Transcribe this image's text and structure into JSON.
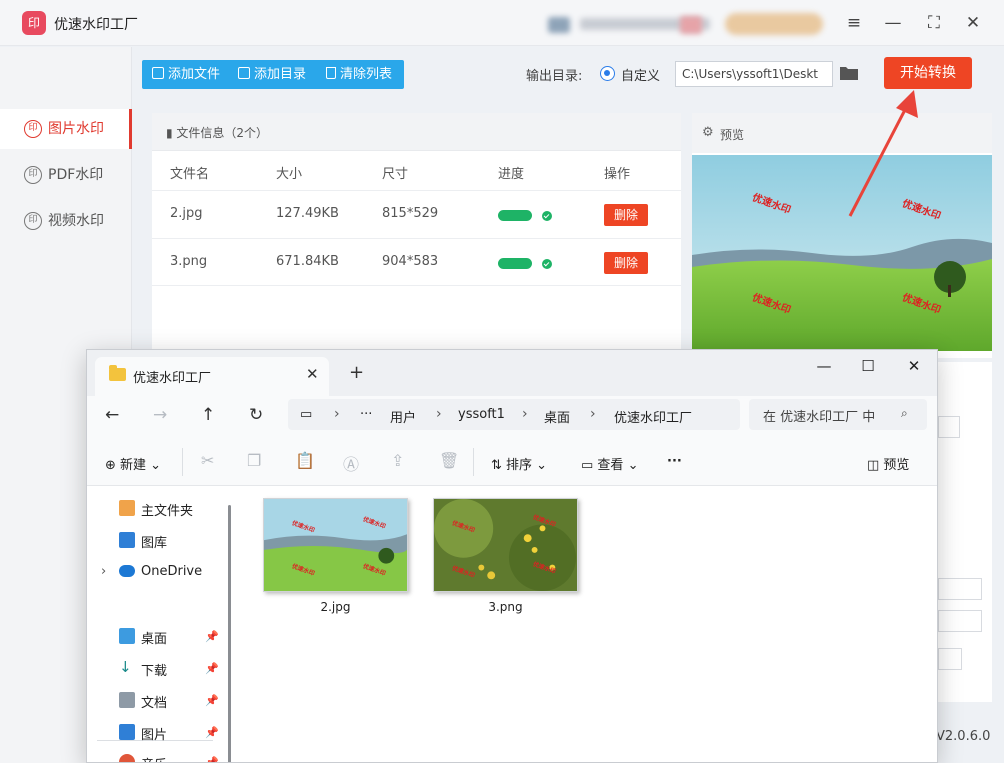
{
  "app": {
    "title": "优速水印工厂",
    "logo_text": "印",
    "version": "V2.0.6.0",
    "window_controls": [
      "≡",
      "—",
      "⛶",
      "✕"
    ]
  },
  "nav": {
    "items": [
      {
        "label": "图片水印",
        "icon": "印",
        "active": true
      },
      {
        "label": "PDF水印",
        "icon": "印",
        "active": false
      },
      {
        "label": "视频水印",
        "icon": "印",
        "active": false
      }
    ]
  },
  "toolbar": {
    "add_file": "添加文件",
    "add_dir": "添加目录",
    "clear_list": "清除列表",
    "output_label": "输出目录:",
    "custom_label": "自定义",
    "output_path": "C:\\Users\\yssoft1\\Deskt",
    "start_button": "开始转换",
    "accent": "#2aa7ea",
    "start_color": "#ee4524"
  },
  "file_panel": {
    "header": "文件信息（2个）",
    "columns": [
      "文件名",
      "大小",
      "尺寸",
      "进度",
      "操作"
    ],
    "rows": [
      {
        "name": "2.jpg",
        "size": "127.49KB",
        "dims": "815*529",
        "progress": 1.0,
        "action": "删除"
      },
      {
        "name": "3.png",
        "size": "671.84KB",
        "dims": "904*583",
        "progress": 1.0,
        "action": "删除"
      }
    ]
  },
  "preview": {
    "title": "预览",
    "watermark_text": "优速水印"
  },
  "explorer": {
    "tab_title": "优速水印工厂",
    "new_tab": "+",
    "controls": [
      "—",
      "☐",
      "✕"
    ],
    "breadcrumb": [
      "用户",
      "yssoft1",
      "桌面",
      "优速水印工厂"
    ],
    "more_crumbs": "···",
    "search_placeholder": "在 优速水印工厂 中",
    "commands": {
      "new": "新建",
      "sort": "排序",
      "view": "查看",
      "more": "···",
      "preview": "预览"
    },
    "sidebar": [
      {
        "label": "主文件夹",
        "icon": "home-icon",
        "pinned": false
      },
      {
        "label": "图库",
        "icon": "gallery-icon",
        "pinned": false
      },
      {
        "label": "OneDrive",
        "icon": "cloud-icon",
        "pinned": false
      },
      {
        "label": "桌面",
        "icon": "desktop-icon",
        "pinned": true
      },
      {
        "label": "下载",
        "icon": "download-icon",
        "pinned": true
      },
      {
        "label": "文档",
        "icon": "document-icon",
        "pinned": true
      },
      {
        "label": "图片",
        "icon": "picture-icon",
        "pinned": true
      },
      {
        "label": "音乐",
        "icon": "music-icon",
        "pinned": true
      }
    ],
    "files": [
      {
        "name": "2.jpg"
      },
      {
        "name": "3.png"
      }
    ]
  }
}
